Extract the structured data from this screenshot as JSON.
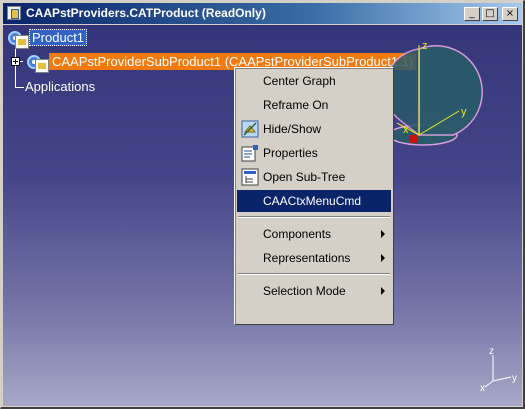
{
  "window": {
    "title": "CAAPstProviders.CATProduct (ReadOnly)",
    "minimize_glyph": "_",
    "restore_glyph": "□",
    "close_glyph": "×"
  },
  "tree": {
    "root_label": "Product1",
    "child_label": "CAAPstProviderSubProduct1 (CAAPstProviderSubProduct1.1)",
    "applications_label": "Applications"
  },
  "compass": {
    "z_label": "z",
    "y_label": "y",
    "x_label": "x"
  },
  "triad": {
    "z_label": "z",
    "y_label": "y",
    "x_label": "x"
  },
  "context_menu": {
    "center_graph": "Center Graph",
    "reframe_on": "Reframe On",
    "hide_show": "Hide/Show",
    "properties": "Properties",
    "open_sub_tree": "Open Sub-Tree",
    "custom_cmd": "CAACtxMenuCmd",
    "components": "Components",
    "representations": "Representations",
    "selection_mode": "Selection Mode"
  },
  "colors": {
    "viewport_top": "#35357a",
    "viewport_bottom": "#a8a8c8",
    "selection": "#0a246a",
    "sub_product_highlight": "#f07a10",
    "root_highlight": "#3163c5",
    "compass_fill": "#2a5a6a",
    "compass_line": "#e0a0e0"
  },
  "icons": [
    "gear-icon",
    "document-icon",
    "expand-plus-icon",
    "hide-show-icon",
    "properties-icon",
    "sub-tree-icon",
    "submenu-arrow-icon",
    "compass-icon",
    "axis-triad-icon"
  ]
}
